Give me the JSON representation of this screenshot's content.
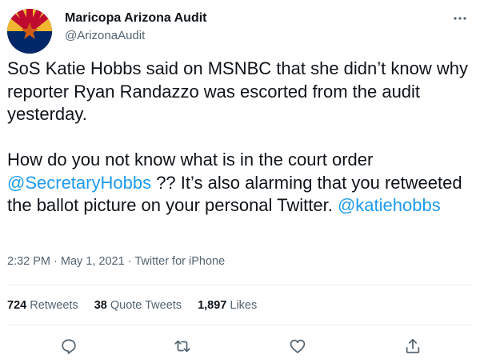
{
  "author": {
    "display_name": "Maricopa Arizona Audit",
    "handle": "@ArizonaAudit",
    "avatar_icon": "arizona-flag-avatar"
  },
  "tweet": {
    "paragraph1": "SoS Katie Hobbs said on MSNBC that she didn’t know why reporter Ryan Randazzo was escorted from the audit yesterday.",
    "p2_text_a": "How do you not know what is in the court order ",
    "p2_mention_1": "@SecretaryHobbs",
    "p2_text_b": " ?? It’s also alarming that you retweeted the ballot picture on your personal Twitter. ",
    "p2_mention_2": "@katiehobbs"
  },
  "meta": {
    "time": "2:32 PM",
    "separator": " · ",
    "date": "May 1, 2021",
    "source": "Twitter for iPhone"
  },
  "stats": {
    "retweets_count": "724",
    "retweets_label": "Retweets",
    "quotes_count": "38",
    "quotes_label": "Quote Tweets",
    "likes_count": "1,897",
    "likes_label": "Likes"
  },
  "actions": [
    "reply-icon",
    "retweet-icon",
    "like-icon",
    "share-icon"
  ],
  "colors": {
    "link": "#1d9bf0",
    "secondary_text": "#536471",
    "divider": "#e6ecf0"
  }
}
